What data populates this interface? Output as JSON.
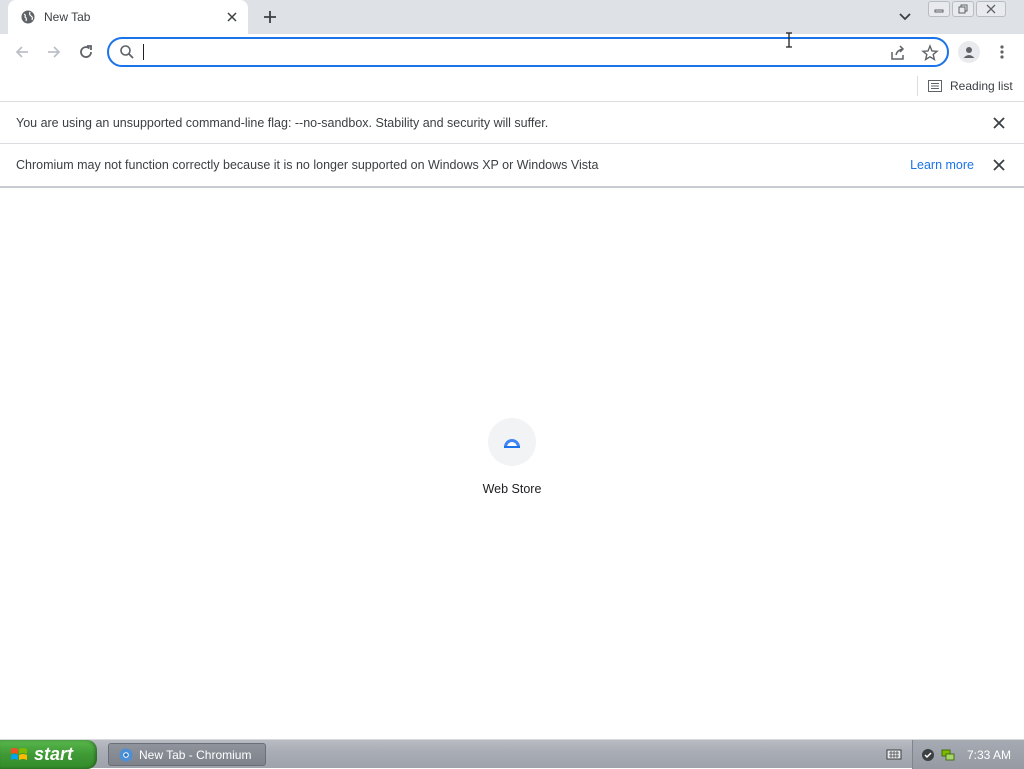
{
  "browser": {
    "tab": {
      "title": "New Tab",
      "favicon": "globe-icon"
    },
    "omnibox": {
      "value": "",
      "placeholder": ""
    },
    "bookmarks_bar": {
      "reading_list_label": "Reading list"
    }
  },
  "infobars": [
    {
      "message": "You are using an unsupported command-line flag: --no-sandbox. Stability and security will suffer."
    },
    {
      "message": "Chromium may not function correctly because it is no longer supported on Windows XP or Windows Vista",
      "link": "Learn more"
    }
  ],
  "new_tab_page": {
    "shortcuts": [
      {
        "label": "Web Store",
        "icon": "web-store-icon"
      }
    ]
  },
  "taskbar": {
    "start_label": "start",
    "items": [
      {
        "label": "New Tab - Chromium"
      }
    ],
    "clock": "7:33 AM"
  },
  "colors": {
    "accent": "#1a73e8",
    "tabstrip": "#dee1e6",
    "start_green": "#3f9a35"
  }
}
